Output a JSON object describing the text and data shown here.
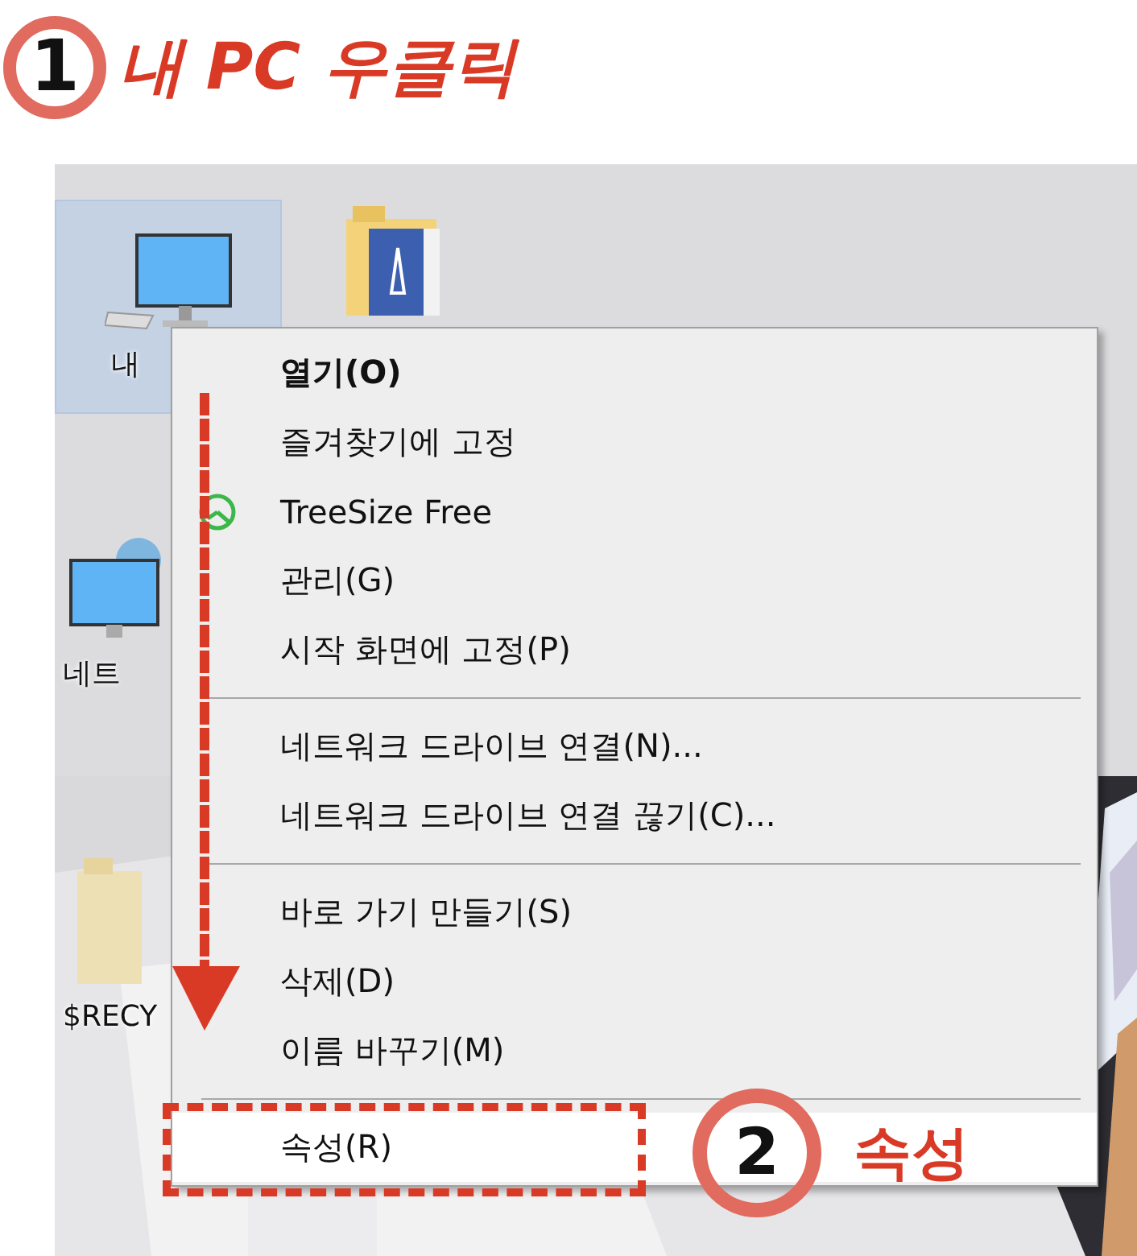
{
  "heading": {
    "number": "1",
    "text": "내 PC 우클릭"
  },
  "desktop_icons": [
    {
      "kind": "pc",
      "label": "내",
      "selected": true
    },
    {
      "kind": "folder-doc",
      "selected": false
    },
    {
      "kind": "network",
      "label": "네트",
      "selected": false
    },
    {
      "kind": "folder",
      "label": "$RECY",
      "selected": false
    }
  ],
  "context_menu": {
    "items": [
      {
        "kind": "item",
        "label": "열기(O)",
        "default": true,
        "has_icon": false,
        "selected": false
      },
      {
        "kind": "item",
        "label": "즐겨찾기에 고정",
        "default": false,
        "has_icon": false,
        "selected": false
      },
      {
        "kind": "item",
        "label": "TreeSize Free",
        "default": false,
        "has_icon": true,
        "selected": false
      },
      {
        "kind": "item",
        "label": "관리(G)",
        "default": false,
        "has_icon": false,
        "selected": false
      },
      {
        "kind": "item",
        "label": "시작 화면에 고정(P)",
        "default": false,
        "has_icon": false,
        "selected": false
      },
      {
        "kind": "separator"
      },
      {
        "kind": "item",
        "label": "네트워크 드라이브 연결(N)...",
        "default": false,
        "has_icon": false,
        "selected": false
      },
      {
        "kind": "item",
        "label": "네트워크 드라이브 연결 끊기(C)...",
        "default": false,
        "has_icon": false,
        "selected": false
      },
      {
        "kind": "separator"
      },
      {
        "kind": "item",
        "label": "바로 가기 만들기(S)",
        "default": false,
        "has_icon": false,
        "selected": false
      },
      {
        "kind": "item",
        "label": "삭제(D)",
        "default": false,
        "has_icon": false,
        "selected": false
      },
      {
        "kind": "item",
        "label": "이름 바꾸기(M)",
        "default": false,
        "has_icon": false,
        "selected": false
      },
      {
        "kind": "separator"
      },
      {
        "kind": "item",
        "label": "속성(R)",
        "default": false,
        "has_icon": false,
        "selected": true
      }
    ]
  },
  "callout": {
    "number": "2",
    "text": "속성"
  }
}
